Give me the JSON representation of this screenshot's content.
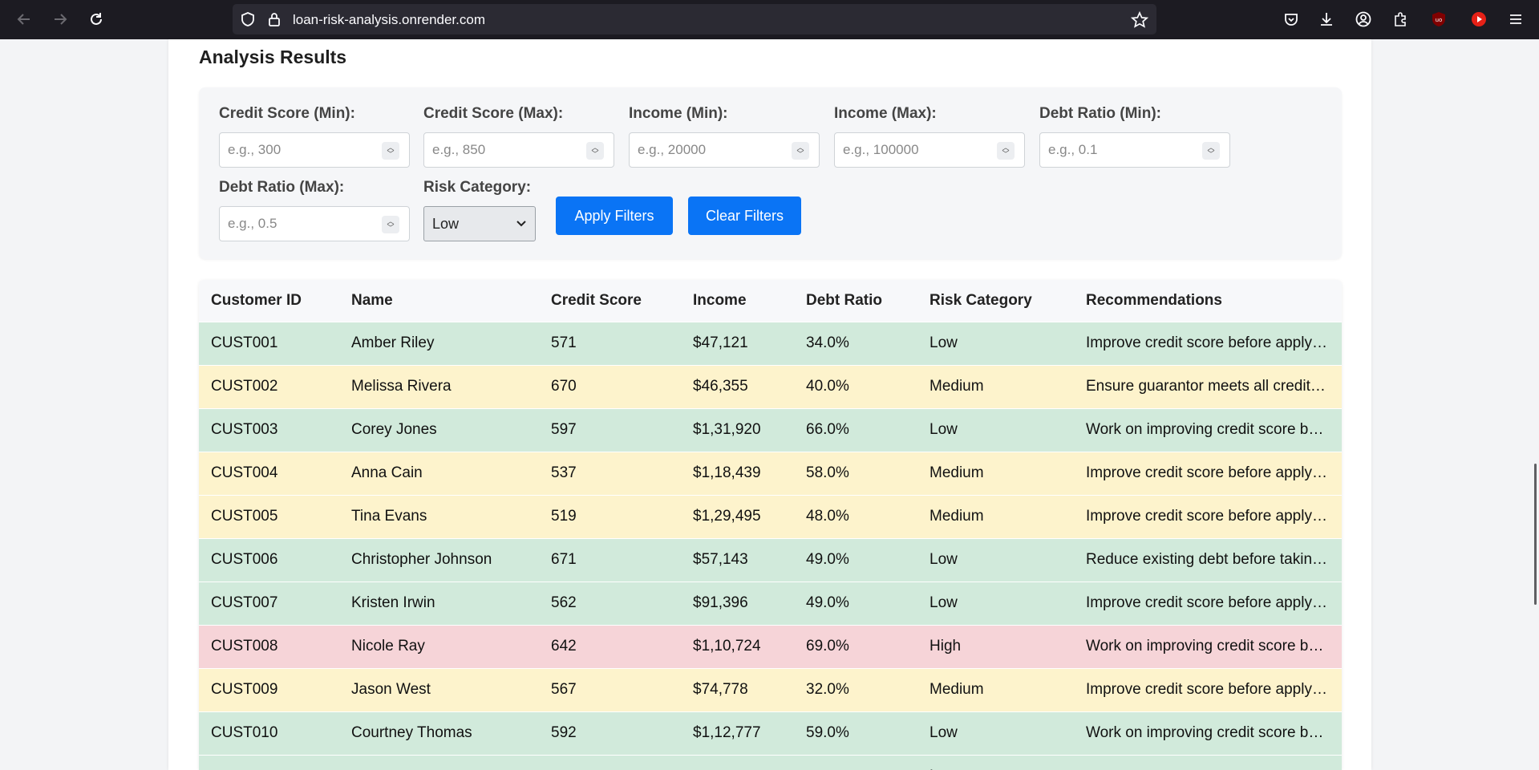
{
  "browser": {
    "url": "loan-risk-analysis.onrender.com"
  },
  "page": {
    "section_title": "Analysis Results"
  },
  "filters": {
    "credit_min": {
      "label": "Credit Score (Min):",
      "placeholder": "e.g., 300"
    },
    "credit_max": {
      "label": "Credit Score (Max):",
      "placeholder": "e.g., 850"
    },
    "income_min": {
      "label": "Income (Min):",
      "placeholder": "e.g., 20000"
    },
    "income_max": {
      "label": "Income (Max):",
      "placeholder": "e.g., 100000"
    },
    "debt_min": {
      "label": "Debt Ratio (Min):",
      "placeholder": "e.g., 0.1"
    },
    "debt_max": {
      "label": "Debt Ratio (Max):",
      "placeholder": "e.g., 0.5"
    },
    "risk": {
      "label": "Risk Category:",
      "selected": "Low"
    },
    "apply_label": "Apply Filters",
    "clear_label": "Clear Filters"
  },
  "table": {
    "headers": [
      "Customer ID",
      "Name",
      "Credit Score",
      "Income",
      "Debt Ratio",
      "Risk Category",
      "Recommendations"
    ],
    "rows": [
      {
        "id": "CUST001",
        "name": "Amber Riley",
        "credit": "571",
        "income": "$47,121",
        "debt": "34.0%",
        "risk": "Low",
        "rec": "Improve credit score before applying"
      },
      {
        "id": "CUST002",
        "name": "Melissa Rivera",
        "credit": "670",
        "income": "$46,355",
        "debt": "40.0%",
        "risk": "Medium",
        "rec": "Ensure guarantor meets all credit requirements"
      },
      {
        "id": "CUST003",
        "name": "Corey Jones",
        "credit": "597",
        "income": "$1,31,920",
        "debt": "66.0%",
        "risk": "Low",
        "rec": "Work on improving credit score before applying"
      },
      {
        "id": "CUST004",
        "name": "Anna Cain",
        "credit": "537",
        "income": "$1,18,439",
        "debt": "58.0%",
        "risk": "Medium",
        "rec": "Improve credit score before applying"
      },
      {
        "id": "CUST005",
        "name": "Tina Evans",
        "credit": "519",
        "income": "$1,29,495",
        "debt": "48.0%",
        "risk": "Medium",
        "rec": "Improve credit score before applying"
      },
      {
        "id": "CUST006",
        "name": "Christopher Johnson",
        "credit": "671",
        "income": "$57,143",
        "debt": "49.0%",
        "risk": "Low",
        "rec": "Reduce existing debt before taking new loans"
      },
      {
        "id": "CUST007",
        "name": "Kristen Irwin",
        "credit": "562",
        "income": "$91,396",
        "debt": "49.0%",
        "risk": "Low",
        "rec": "Improve credit score before applying"
      },
      {
        "id": "CUST008",
        "name": "Nicole Ray",
        "credit": "642",
        "income": "$1,10,724",
        "debt": "69.0%",
        "risk": "High",
        "rec": "Work on improving credit score before applying"
      },
      {
        "id": "CUST009",
        "name": "Jason West",
        "credit": "567",
        "income": "$74,778",
        "debt": "32.0%",
        "risk": "Medium",
        "rec": "Improve credit score before applying"
      },
      {
        "id": "CUST010",
        "name": "Courtney Thomas",
        "credit": "592",
        "income": "$1,12,777",
        "debt": "59.0%",
        "risk": "Low",
        "rec": "Work on improving credit score before applying"
      },
      {
        "id": "",
        "name": "",
        "credit": "",
        "income": "",
        "debt": "",
        "risk": "Low",
        "rec": ""
      }
    ]
  },
  "colors": {
    "low": "#d1eadb",
    "medium": "#fdf3cc",
    "high": "#f6d4d8",
    "accent": "#0a74f5"
  }
}
